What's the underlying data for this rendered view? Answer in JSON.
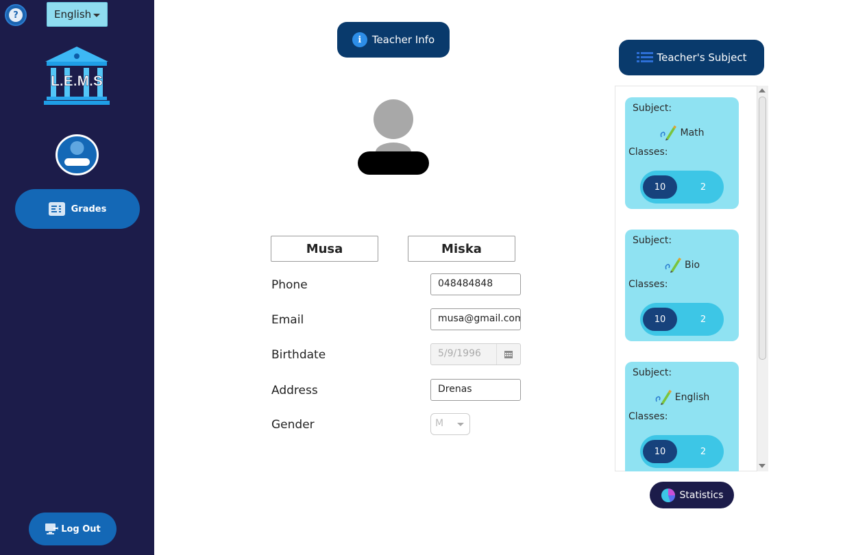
{
  "sidebar": {
    "help_glyph": "?",
    "language": "English",
    "logo_text": "L.E.M.S",
    "nav": [
      {
        "label": "Grades",
        "icon": "list-icon"
      }
    ],
    "logout_label": "Log Out"
  },
  "profile": {
    "header_label": "Teacher Info",
    "first_name": "Musa",
    "last_name": "Miska",
    "fields": {
      "phone": {
        "label": "Phone",
        "value": "048484848"
      },
      "email": {
        "label": "Email",
        "value": "musa@gmail.com"
      },
      "birthdate": {
        "label": "Birthdate",
        "value": "5/9/1996"
      },
      "address": {
        "label": "Address",
        "value": "Drenas"
      },
      "gender": {
        "label": "Gender",
        "value": "M"
      }
    }
  },
  "subjects": {
    "header_label": "Teacher's Subject",
    "subject_label": "Subject:",
    "classes_label": "Classes:",
    "items": [
      {
        "name": "Math",
        "classes": [
          "10",
          "2"
        ]
      },
      {
        "name": "Bio",
        "classes": [
          "10",
          "2"
        ]
      },
      {
        "name": "English",
        "classes": [
          "10",
          "2"
        ]
      }
    ],
    "statistics_label": "Statistics"
  },
  "colors": {
    "sidebar_bg": "#1c1c4a",
    "primary_button": "#1468b6",
    "header_button": "#093a6c",
    "card_bg": "#8fe2f2",
    "class_pill": "#3dc6e6",
    "class_selected": "#17427c"
  }
}
